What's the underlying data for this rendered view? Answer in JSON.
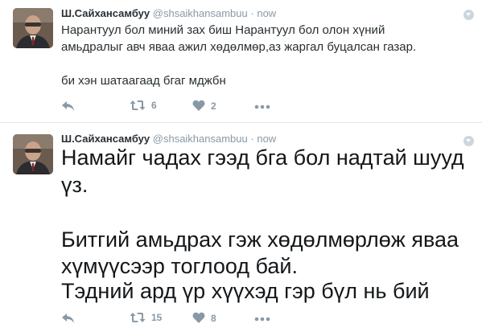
{
  "tweets": [
    {
      "name": "Ш.Сайхансамбуу",
      "handle": "@shsaikhansambuu",
      "separator": "·",
      "time": "now",
      "lines": [
        "Нарантуул бол миний зах биш Нарантуул бол олон хүний",
        "амьдралыг авч яваа ажил хөдөлмөр,аз жаргал буцалсан газар.",
        "би хэн шатаагаад бгаг мджбн"
      ],
      "retweets": "6",
      "likes": "2"
    },
    {
      "name": "Ш.Сайхансамбуу",
      "handle": "@shsaikhansambuu",
      "separator": "·",
      "time": "now",
      "lines": [
        "Намайг чадах гээд бга бол надтай шууд",
        "үз.",
        "Битгий амьдрах гэж хөдөлмөрлөж яваа",
        "хүмүүсээр тоглоод бай.",
        "Тэдний ард үр хүүхэд гэр бүл нь бий"
      ],
      "retweets": "15",
      "likes": "8"
    }
  ],
  "icons": {
    "reply": "reply-icon",
    "retweet": "retweet-icon",
    "like": "heart-icon",
    "more": "more-icon",
    "caret": "chevron-down-icon"
  },
  "colors": {
    "text": "#292f33",
    "muted": "#8899a6",
    "divider": "#e1e8ed"
  }
}
